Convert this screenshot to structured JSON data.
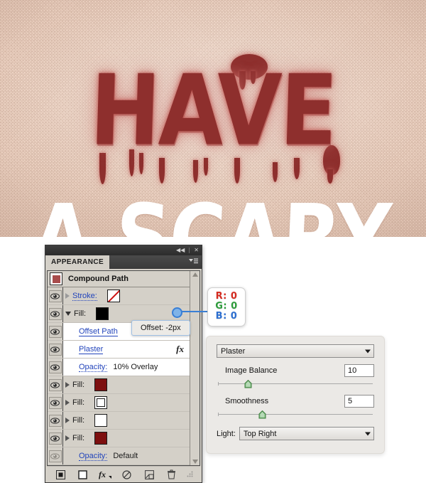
{
  "artwork": {
    "line1": "HAVE",
    "line2": "A SCARY",
    "background_color": "#ecd2c2",
    "graffiti_color": "#8e2f2d",
    "white_text_color": "#ffffff"
  },
  "panel": {
    "titlebar": {
      "collapse_icon": "◀◀",
      "close_icon": "✕"
    },
    "tab_label": "APPEARANCE",
    "menu_icon": "panel-menu-icon",
    "object_title": "Compound Path",
    "thumbnail_color": "#a84c4c",
    "rows": [
      {
        "label": "Stroke:",
        "type": "link",
        "swatch": "none",
        "visible": true,
        "expander": "right",
        "indent": false,
        "shaded": true
      },
      {
        "label": "Fill:",
        "type": "plain",
        "swatch": "black",
        "visible": true,
        "expander": "down",
        "indent": false,
        "shaded": true
      },
      {
        "label": "Offset Path",
        "type": "link-solid",
        "swatch": null,
        "visible": true,
        "expander": "none",
        "indent": true,
        "shaded": false
      },
      {
        "label": "Plaster",
        "type": "link-solid",
        "swatch": null,
        "visible": true,
        "expander": "none",
        "indent": true,
        "shaded": false,
        "fx": "fx"
      },
      {
        "label": "Opacity:",
        "type": "link",
        "value": "10% Overlay",
        "swatch": null,
        "visible": true,
        "expander": "none",
        "indent": true,
        "shaded": false
      },
      {
        "label": "Fill:",
        "type": "plain",
        "swatch": "darkred",
        "visible": true,
        "expander": "right",
        "indent": false,
        "shaded": true
      },
      {
        "label": "Fill:",
        "type": "plain",
        "swatch": "whiteb",
        "visible": true,
        "expander": "right",
        "indent": false,
        "shaded": true
      },
      {
        "label": "Fill:",
        "type": "plain",
        "swatch": "white",
        "visible": true,
        "expander": "right",
        "indent": false,
        "shaded": true
      },
      {
        "label": "Fill:",
        "type": "plain",
        "swatch": "darkred",
        "visible": true,
        "expander": "right",
        "indent": false,
        "shaded": true
      },
      {
        "label": "Opacity:",
        "type": "link",
        "value": "Default",
        "swatch": null,
        "visible": false,
        "expander": "none",
        "indent": true,
        "shaded": true
      }
    ],
    "toolbar": [
      {
        "name": "add-new-stroke-button",
        "icon": "filled-square-icon"
      },
      {
        "name": "add-new-fill-button",
        "icon": "outline-square-icon"
      },
      {
        "name": "add-new-effect-button",
        "icon": "fx-icon"
      },
      {
        "name": "clear-appearance-button",
        "icon": "no-symbol-icon"
      },
      {
        "name": "duplicate-selected-item-button",
        "icon": "duplicate-icon"
      },
      {
        "name": "delete-selected-item-button",
        "icon": "trash-icon"
      }
    ],
    "scrollbar": {
      "up": "scroll-up-arrow",
      "down": "scroll-down-arrow"
    }
  },
  "rgb_callout": {
    "r": "R: 0",
    "g": "G: 0",
    "b": "B: 0",
    "r_color": "#d42b20",
    "g_color": "#2e9c3c",
    "b_color": "#2d6fd0"
  },
  "offset_tooltip": {
    "text": "Offset: -2px"
  },
  "plaster_dialog": {
    "effect_select": "Plaster",
    "image_balance": {
      "label": "Image Balance",
      "value": "10",
      "slider_pct": 20
    },
    "smoothness": {
      "label": "Smoothness",
      "value": "5",
      "slider_pct": 29
    },
    "light": {
      "label": "Light:",
      "value": "Top Right"
    },
    "handle_color": "#4c9a4c"
  }
}
